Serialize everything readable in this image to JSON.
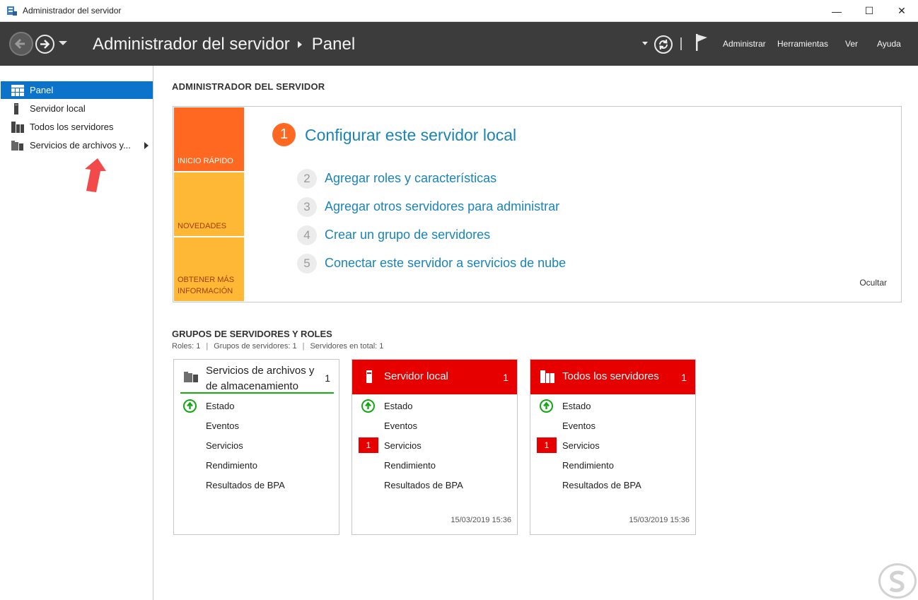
{
  "window": {
    "title": "Administrador del servidor",
    "controls": {
      "minimize": "—",
      "maximize": "☐",
      "close": "✕"
    }
  },
  "header": {
    "breadcrumb": [
      "Administrador del servidor",
      "Panel"
    ],
    "menu": [
      "Administrar",
      "Herramientas",
      "Ver",
      "Ayuda"
    ]
  },
  "sidebar": {
    "items": [
      {
        "label": "Panel",
        "icon": "dashboard-icon",
        "active": true
      },
      {
        "label": "Servidor local",
        "icon": "server-icon"
      },
      {
        "label": "Todos los servidores",
        "icon": "servers-icon"
      },
      {
        "label": "Servicios de archivos y...",
        "icon": "file-services-icon",
        "expandable": true
      }
    ]
  },
  "welcome": {
    "section_title": "ADMINISTRADOR DEL SERVIDOR",
    "tiles": [
      "INICIO RÁPIDO",
      "NOVEDADES",
      "OBTENER MÁS INFORMACIÓN"
    ],
    "steps": [
      {
        "num": "1",
        "label": "Configurar este servidor local"
      },
      {
        "num": "2",
        "label": "Agregar roles y características"
      },
      {
        "num": "3",
        "label": "Agregar otros servidores para administrar"
      },
      {
        "num": "4",
        "label": "Crear un grupo de servidores"
      },
      {
        "num": "5",
        "label": "Conectar este servidor a servicios de nube"
      }
    ],
    "hide_label": "Ocultar"
  },
  "groups": {
    "title": "GRUPOS DE SERVIDORES Y ROLES",
    "summary": [
      "Roles: 1",
      "Grupos de servidores: 1",
      "Servidores en total: 1"
    ],
    "cards": [
      {
        "title_line1": "Servicios de archivos y",
        "title_line2": "de almacenamiento",
        "count": "1",
        "rows": [
          "Estado",
          "Eventos",
          "Servicios",
          "Rendimiento",
          "Resultados de BPA"
        ],
        "timestamp": ""
      },
      {
        "title": "Servidor local",
        "count": "1",
        "rows": [
          "Estado",
          "Eventos",
          "Servicios",
          "Rendimiento",
          "Resultados de BPA"
        ],
        "service_badge": "1",
        "timestamp": "15/03/2019 15:36"
      },
      {
        "title": "Todos los servidores",
        "count": "1",
        "rows": [
          "Estado",
          "Eventos",
          "Servicios",
          "Rendimiento",
          "Resultados de BPA"
        ],
        "service_badge": "1",
        "timestamp": "15/03/2019 15:36"
      }
    ]
  },
  "colors": {
    "accent_blue": "#0b73c9",
    "link_blue": "#1a84b8",
    "quick_start_orange": "#ff6820",
    "tile_yellow": "#ffb836",
    "alert_red": "#e60000",
    "ok_green": "#12a812",
    "header_dark": "#3c3c3c"
  }
}
